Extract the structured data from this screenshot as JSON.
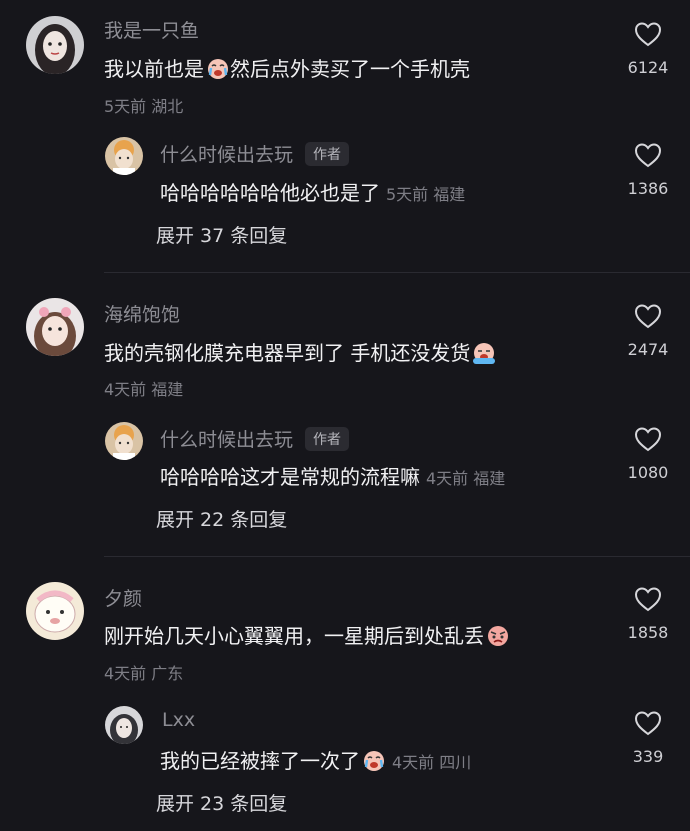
{
  "threads": [
    {
      "comment": {
        "name": "我是一只鱼",
        "text": "我以前也是",
        "text2": "然后点外卖买了一个手机壳",
        "meta": "5天前 湖北",
        "likes": "6124",
        "emoji": "crying-face"
      },
      "reply": {
        "name": "什么时候出去玩",
        "badge": "作者",
        "text": "哈哈哈哈哈哈他必也是了",
        "meta": "5天前 福建",
        "likes": "1386"
      },
      "expand": "展开 37 条回复"
    },
    {
      "comment": {
        "name": "海绵饱饱",
        "text": "我的壳钢化膜充电器早到了 手机还没发货",
        "meta": "4天前 福建",
        "likes": "2474",
        "emoji": "sobbing-face"
      },
      "reply": {
        "name": "什么时候出去玩",
        "badge": "作者",
        "text": "哈哈哈哈这才是常规的流程嘛",
        "meta": "4天前 福建",
        "likes": "1080"
      },
      "expand": "展开 22 条回复"
    },
    {
      "comment": {
        "name": "夕颜",
        "text": "刚开始几天小心翼翼用，一星期后到处乱丢",
        "meta": "4天前 广东",
        "likes": "1858",
        "emoji": "angry-face"
      },
      "reply": {
        "name": "Lxx",
        "text": "我的已经被摔了一次了",
        "meta": "4天前 四川",
        "likes": "339",
        "emoji": "crying-face"
      },
      "expand": "展开 23 条回复"
    }
  ]
}
